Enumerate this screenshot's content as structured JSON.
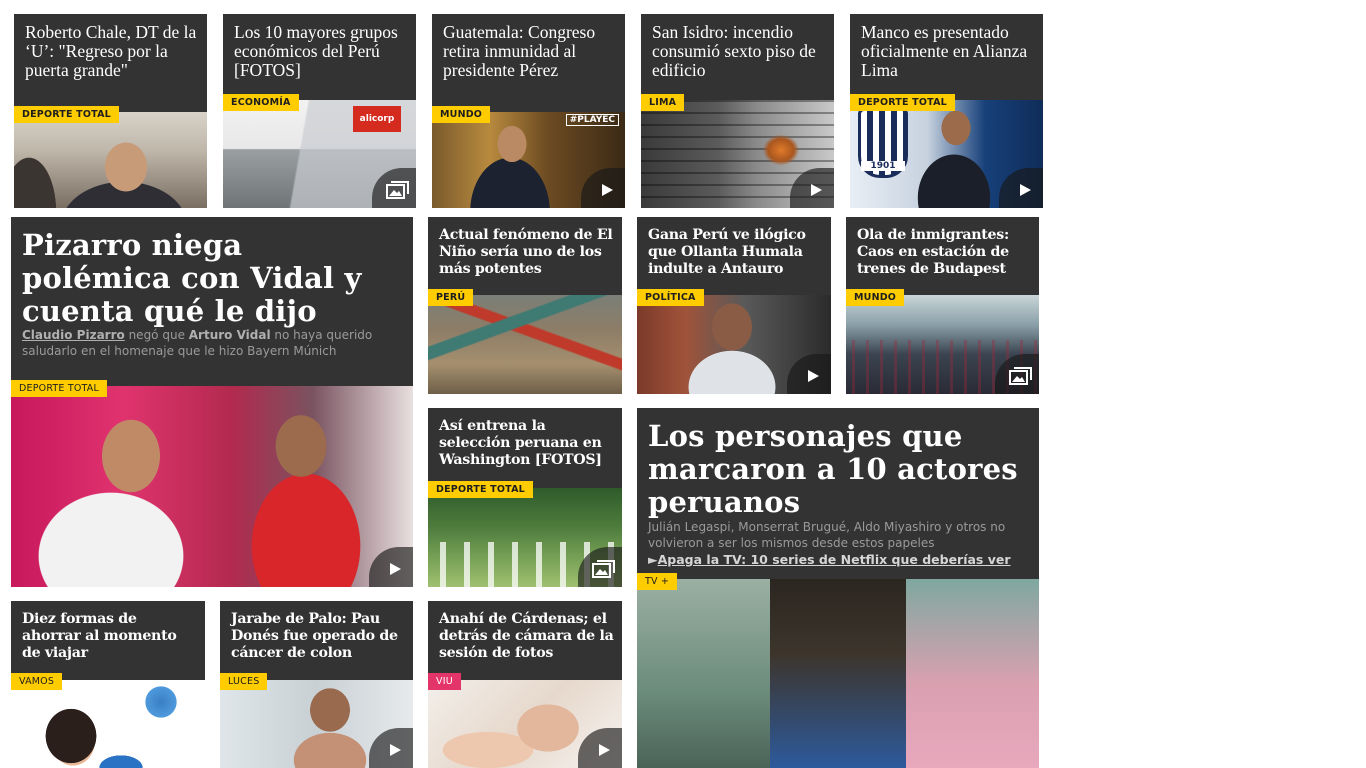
{
  "cards": [
    {
      "title": "Roberto Chale, DT de la ‘U’: \"Regreso por la puerta grande\"",
      "section": "DEPORTE TOTAL",
      "icon": "none"
    },
    {
      "title": "Los 10 mayores grupos económicos del Perú [FOTOS]",
      "section": "ECONOMÍA",
      "icon": "gallery-icon",
      "sign": "alicorp"
    },
    {
      "title": "Guatemala: Congreso retira inmunidad al presidente Pérez",
      "section": "MUNDO",
      "icon": "play-icon",
      "watermark": "#PLAYEC"
    },
    {
      "title": "San Isidro: incendio consumió sexto piso de edificio",
      "section": "LIMA",
      "icon": "play-icon"
    },
    {
      "title": "Manco es presentado oficialmente en Alianza Lima",
      "section": "DEPORTE TOTAL",
      "icon": "play-icon",
      "crest": "1901"
    },
    {
      "title": "Actual fenómeno de El Niño sería uno de los más potentes",
      "section": "PERÚ",
      "icon": "none"
    },
    {
      "title": "Gana Perú ve ilógico que Ollanta Humala indulte a Antauro",
      "section": "POLÍTICA",
      "icon": "play-icon"
    },
    {
      "title": "Ola de inmigrantes: Caos en estación de trenes de Budapest",
      "section": "MUNDO",
      "icon": "gallery-icon"
    },
    {
      "title": "Así entrena la selección peruana en Washington [FOTOS]",
      "section": "DEPORTE TOTAL",
      "icon": "gallery-icon"
    },
    {
      "title": "Diez formas de ahorrar al momento de viajar",
      "section": "VAMOS",
      "icon": "none"
    },
    {
      "title": "Jarabe de Palo: Pau Donés fue operado de cáncer de colon",
      "section": "LUCES",
      "icon": "play-icon"
    },
    {
      "title": "Anahí de Cárdenas; el detrás de cámara de la sesión de fotos",
      "section": "VIU",
      "icon": "play-icon"
    }
  ],
  "featured": {
    "title": "Pizarro niega polémica con Vidal y cuenta qué le dijo",
    "summary_name1": "Claudio Pizarro",
    "summary_mid": " negó que ",
    "summary_name2": "Arturo Vidal",
    "summary_end": " no haya querido saludarlo en el homenaje que le hizo Bayern Múnich",
    "section": "DEPORTE TOTAL",
    "icon": "play-icon"
  },
  "featured2": {
    "title": "Los personajes que marcaron a 10 actores peruanos",
    "summary": "Julián Legaspi, Monserrat Brugué, Aldo Miyashiro y otros no volvieron a ser los mismos desde estos papeles",
    "related_arrow": "►",
    "related": "Apaga la TV: 10 series de Netflix que deberías ver",
    "section": "TV +"
  },
  "colors": {
    "card_bg": "#333333",
    "tag_yellow": "#ffcc00",
    "tag_pink": "#e4356b"
  }
}
